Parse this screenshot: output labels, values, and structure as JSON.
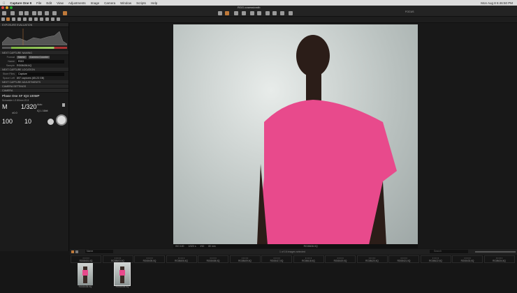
{
  "menubar": {
    "app": "Capture One 9",
    "items": [
      "File",
      "Edit",
      "View",
      "Adjustments",
      "Image",
      "Camera",
      "Window",
      "Scripts",
      "Help"
    ],
    "clock": "Mon Aug 8  6:46:50 PM"
  },
  "window_title": "RGG.cosessiondb",
  "focus_label": "FOCUS",
  "left": {
    "exposure_title": "EXPOSURE EVALUATION",
    "naming_title": "NEXT CAPTURE NAMING",
    "format_label": "Format",
    "format_tokens": [
      "Name",
      "Camera Counter"
    ],
    "name_label": "Name",
    "name_value": "RGG",
    "sample_label": "Sample",
    "sample_value": "RG08436.IIQ",
    "location_title": "NEXT CAPTURE LOCATION",
    "store_label": "Store Files",
    "store_value": "Capture",
    "space_label": "Space Left",
    "space_value": "897 captures (65.23 GB)",
    "adjust_title": "NEXT CAPTURE ADJUSTMENTS",
    "settings_title": "CAMERA SETTINGS",
    "camera_title": "CAMERA",
    "camera_model": "Phase One XF IQ3 100MP",
    "lens": "Schneider LS 80mm f/2.8",
    "mode": "M",
    "shutter": "1/320",
    "ev": "±0.0",
    "iso": "100",
    "aperture": "10",
    "wb": "Auto",
    "format": "IQ L 16bit"
  },
  "photo_info": [
    "ISO 100",
    "1/320 s",
    "f/10",
    "80 mm"
  ],
  "photo_name": "RG08436.IIQ",
  "filmstrip": {
    "sort": "Name",
    "status": "1 of 16 images selected",
    "search_placeholder": "Search",
    "grid": [
      "RG08401.IIQ",
      "RG08403.IIQ",
      "RG08405.IIQ",
      "RG08406.IIQ",
      "RG08408.IIQ",
      "RG08409.IIQ",
      "RG08417.IIQ",
      "RG08418.IIQ",
      "RG08419.IIQ",
      "RG08420.IIQ",
      "RG08421.IIQ",
      "RG08422.IIQ",
      "RG08433.IIQ",
      "RG08434.IIQ"
    ],
    "thumbs": [
      "RG08435.IIQ",
      "RG08436.IIQ"
    ]
  },
  "colors": {
    "accent": "#c07a3a",
    "shirt": "#e84a8c"
  }
}
